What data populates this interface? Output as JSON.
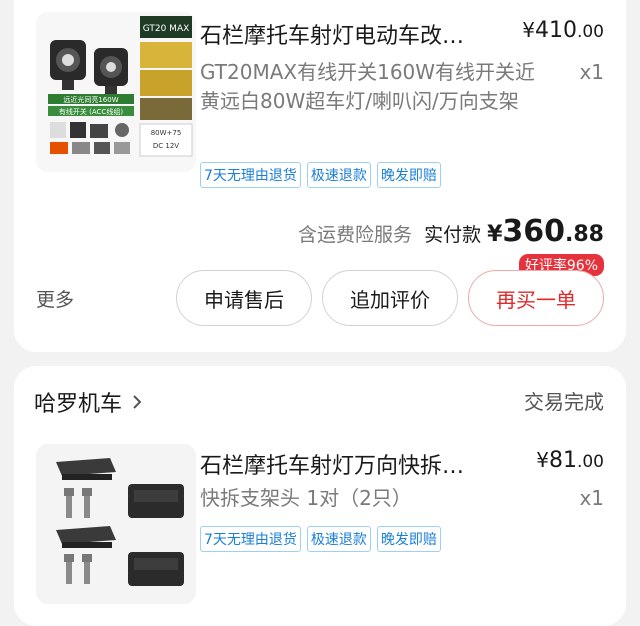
{
  "order1": {
    "title": "石栏摩托车射灯电动车改…",
    "price_yen": "¥",
    "price_int": "410",
    "price_frac": ".00",
    "spec": "GT20MAX有线开关160W有线开关近黄远白80W超车灯/喇叭闪/万向支架",
    "qty": "x1",
    "tags": [
      "7天无理由退货",
      "极速退款",
      "晚发即赔"
    ],
    "insurance": "含运费险服务",
    "paid_label": "实付款",
    "paid_yen": "¥",
    "paid_int": "360",
    "paid_frac": ".88",
    "rating_badge": "好评率96%",
    "more": "更多",
    "buttons": {
      "after_sale": "申请售后",
      "add_review": "追加评价",
      "buy_again": "再买一单"
    },
    "thumb_text": {
      "box": "GT20 MAX",
      "line1": "远近光同亮160W",
      "line2": "有线开关 (ACC线组)",
      "spec1": "80W+75",
      "spec2": "DC 12V"
    }
  },
  "order2": {
    "store": "哈罗机车",
    "status": "交易完成",
    "title": "石栏摩托车射灯万向快拆…",
    "price_yen": "¥",
    "price_int": "81",
    "price_frac": ".00",
    "spec": "快拆支架头 1对（2只）",
    "qty": "x1",
    "tags": [
      "7天无理由退货",
      "极速退款",
      "晚发即赔"
    ]
  },
  "colors": {
    "accent_red": "#e02a2a",
    "tag_blue": "#1a7fd6",
    "badge_red": "#e6323c"
  }
}
